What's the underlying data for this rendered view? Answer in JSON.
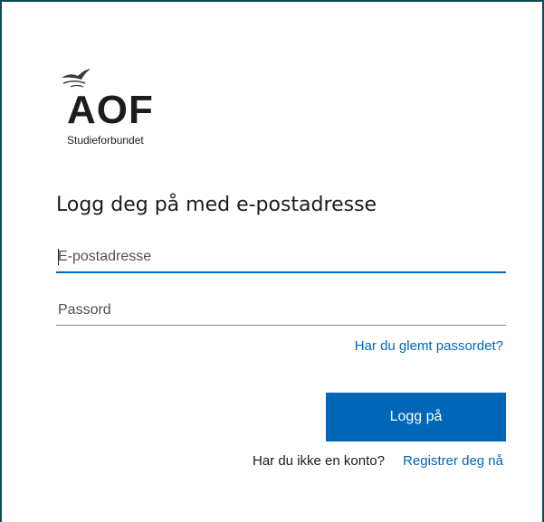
{
  "brand": {
    "logo_text": "AOF",
    "logo_subtitle": "Studieforbundet"
  },
  "login": {
    "title": "Logg deg på med e-postadresse",
    "email_placeholder": "E-postadresse",
    "password_placeholder": "Passord",
    "forgot_password_link": "Har du glemt passordet?",
    "submit_label": "Logg på",
    "no_account_text": "Har du ikke en konto?",
    "register_link": "Registrer deg nå"
  },
  "colors": {
    "accent": "#0067b8",
    "frame_border": "#0f4a54",
    "text": "#1b1b1b"
  },
  "icons": {
    "logo": "aof-bird-logo-icon"
  }
}
